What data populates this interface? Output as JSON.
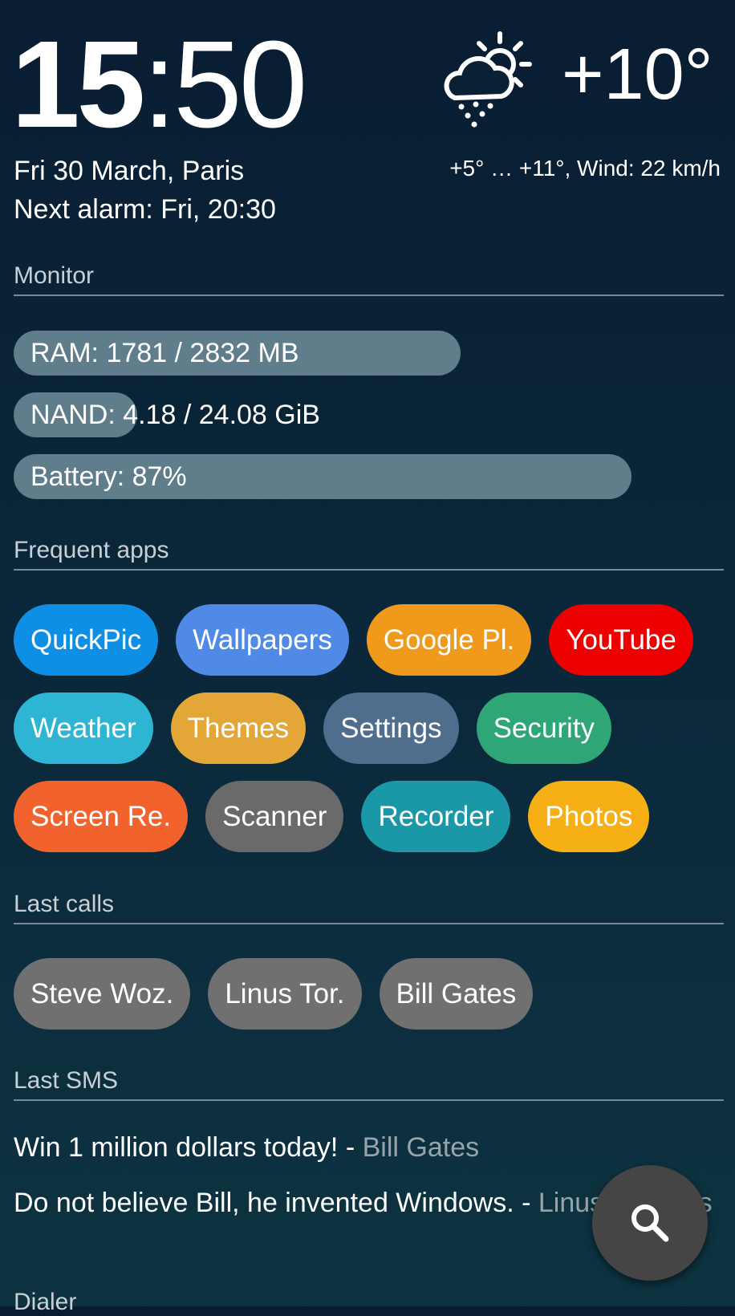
{
  "clock": {
    "hours": "15",
    "separator": ":",
    "minutes": "50"
  },
  "date_line": "Fri 30 March, Paris",
  "alarm_line": "Next alarm: Fri, 20:30",
  "weather": {
    "icon": "rain-sun-cloud-icon",
    "temperature": "+10°",
    "detail": "+5° … +11°, Wind: 22 km/h"
  },
  "monitor": {
    "title": "Monitor",
    "bar_color": "#607d8b",
    "bars": [
      {
        "label": "RAM: 1781 / 2832 MB",
        "fraction": 0.629
      },
      {
        "label": "NAND: 4.18 / 24.08 GiB",
        "fraction": 0.174
      },
      {
        "label": "Battery: 87%",
        "fraction": 0.87
      }
    ]
  },
  "frequent_apps": {
    "title": "Frequent apps",
    "rows": [
      [
        {
          "label": "QuickPic",
          "color": "#0d8fe6"
        },
        {
          "label": "Wallpapers",
          "color": "#4f8be6"
        },
        {
          "label": "Google Pl.",
          "color": "#ef9a1a"
        },
        {
          "label": "YouTube",
          "color": "#ee0000"
        }
      ],
      [
        {
          "label": "Weather",
          "color": "#2eb5d3"
        },
        {
          "label": "Themes",
          "color": "#e3a637"
        },
        {
          "label": "Settings",
          "color": "#4f6e8e"
        },
        {
          "label": "Security",
          "color": "#2fa676"
        }
      ],
      [
        {
          "label": "Screen Re.",
          "color": "#f2622c"
        },
        {
          "label": "Scanner",
          "color": "#6a6a6a"
        },
        {
          "label": "Recorder",
          "color": "#1b98a8"
        },
        {
          "label": "Photos",
          "color": "#f6b016"
        }
      ]
    ]
  },
  "last_calls": {
    "title": "Last calls",
    "chip_color": "#707070",
    "items": [
      "Steve Woz.",
      "Linus Tor.",
      "Bill Gates"
    ]
  },
  "last_sms": {
    "title": "Last SMS",
    "messages": [
      {
        "text": "Win 1 million dollars today! - ",
        "from": "Bill Gates"
      },
      {
        "text": "Do not believe Bill, he invented Windows. - ",
        "from": "Linus Torvalds"
      }
    ]
  },
  "search_fab": {
    "icon": "search-icon"
  },
  "dialer_title": "Dialer"
}
